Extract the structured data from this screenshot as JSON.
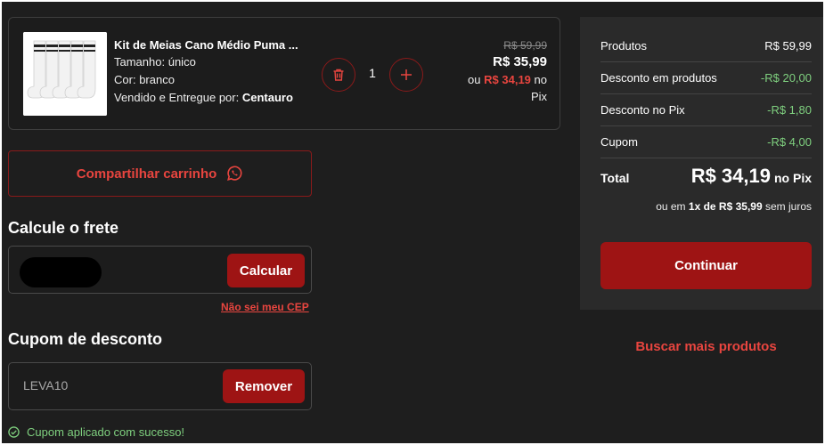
{
  "product": {
    "name": "Kit de Meias Cano Médio Puma ...",
    "size_label": "Tamanho:",
    "size_value": "único",
    "color_label": "Cor:",
    "color_value": "branco",
    "seller_label": "Vendido e Entregue por:",
    "seller_value": "Centauro",
    "quantity": "1",
    "old_price": "R$ 59,99",
    "new_price": "R$ 35,99",
    "pix_prefix": "ou",
    "pix_price": "R$ 34,19",
    "pix_suffix": "no",
    "pix_word": "Pix"
  },
  "share": {
    "label": "Compartilhar carrinho"
  },
  "shipping": {
    "title": "Calcule o frete",
    "button": "Calcular",
    "dont_know_cep": "Não sei meu CEP"
  },
  "coupon": {
    "title": "Cupom de desconto",
    "value": "LEVA10",
    "button": "Remover",
    "success": "Cupom aplicado com sucesso!"
  },
  "summary": {
    "rows": [
      {
        "label": "Produtos",
        "value": "R$ 59,99"
      },
      {
        "label": "Desconto em produtos",
        "value": "-R$ 20,00"
      },
      {
        "label": "Desconto no Pix",
        "value": "-R$ 1,80"
      },
      {
        "label": "Cupom",
        "value": "-R$ 4,00"
      }
    ],
    "total_label": "Total",
    "total_value": "R$ 34,19",
    "total_suffix": "no Pix",
    "inst_prefix": "ou em",
    "inst_bold": "1x de R$ 35,99",
    "inst_suffix": "sem juros",
    "continue": "Continuar"
  },
  "more_products": "Buscar mais produtos",
  "colors": {
    "accent": "#9e1414",
    "accent_text": "#e8453f",
    "success": "#7fd07f",
    "background": "#1e1e1e"
  }
}
